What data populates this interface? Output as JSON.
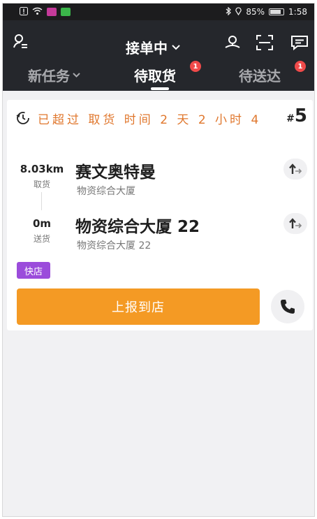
{
  "status_bar": {
    "battery_percent": "85%",
    "time": "1:58",
    "battery_level": 0.85
  },
  "header": {
    "status_label": "接单中",
    "tabs": [
      {
        "label": "新任务",
        "badge": ""
      },
      {
        "label": "待取货",
        "badge": "1"
      },
      {
        "label": "待送达",
        "badge": "1"
      }
    ],
    "active_tab": 1
  },
  "order": {
    "alert_text": "已超过 取货 时间 2 天 2 小时 4",
    "hash": "#",
    "number": "5",
    "pickup": {
      "distance": "8.03km",
      "kind": "取货",
      "name": "赛文奥特曼",
      "address": "物资综合大厦"
    },
    "delivery": {
      "distance": "0m",
      "kind": "送货",
      "name": "物资综合大厦 22",
      "address": "物资综合大厦 22"
    },
    "tag": "快店",
    "report_button": "上报到店"
  },
  "colors": {
    "header_bg": "#25272c",
    "accent_orange": "#f49a24",
    "alert_orange": "#e0772d",
    "tag_purple": "#9b4cdb",
    "badge_red": "#f04a4a"
  }
}
